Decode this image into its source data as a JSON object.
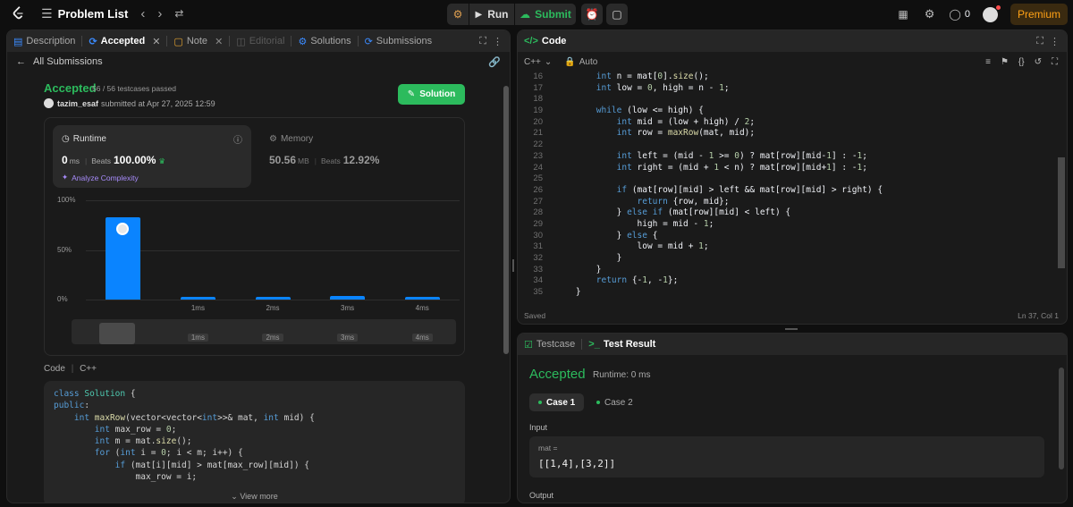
{
  "topbar": {
    "problem_list_label": "Problem List",
    "run_label": "Run",
    "submit_label": "Submit",
    "streak_count": "0",
    "premium_label": "Premium"
  },
  "left_tabs": {
    "description": "Description",
    "accepted": "Accepted",
    "note": "Note",
    "editorial": "Editorial",
    "solutions": "Solutions",
    "submissions": "Submissions"
  },
  "submission": {
    "back_label": "All Submissions",
    "status": "Accepted",
    "testcases": "56 / 56 testcases passed",
    "user": "tazim_esaf",
    "submitted_at": "submitted at Apr 27, 2025 12:59",
    "solution_button": "Solution",
    "runtime": {
      "label": "Runtime",
      "value": "0",
      "unit": "ms",
      "beats_label": "Beats",
      "beats_value": "100.00%",
      "analyze": "Analyze Complexity"
    },
    "memory": {
      "label": "Memory",
      "value": "50.56",
      "unit": "MB",
      "beats_label": "Beats",
      "beats_value": "12.92%"
    },
    "code_label": "Code",
    "lang": "C++",
    "view_more": "View more"
  },
  "chart_data": {
    "type": "bar",
    "y_tick_labels": [
      "100%",
      "50%",
      "0%"
    ],
    "categories": [
      "",
      "1ms",
      "2ms",
      "3ms",
      "4ms"
    ],
    "values": [
      83,
      3,
      3,
      4,
      3
    ],
    "ylim": [
      0,
      100
    ],
    "minimap_labels": [
      "1ms",
      "2ms",
      "3ms",
      "4ms"
    ]
  },
  "submission_code": [
    "class Solution {",
    "public:",
    "    int maxRow(vector<vector<int>>& mat, int mid) {",
    "        int max_row = 0;",
    "        int m = mat.size();",
    "        for (int i = 0; i < m; i++) {",
    "            if (mat[i][mid] > mat[max_row][mid]) {",
    "                max_row = i;"
  ],
  "editor": {
    "title": "Code",
    "lang": "C++",
    "mode": "Auto",
    "saved": "Saved",
    "cursor": "Ln 37, Col 1",
    "start_line": 16,
    "lines": [
      "        int n = mat[0].size();",
      "        int low = 0, high = n - 1;",
      "",
      "        while (low <= high) {",
      "            int mid = (low + high) / 2;",
      "            int row = maxRow(mat, mid);",
      "",
      "            int left = (mid - 1 >= 0) ? mat[row][mid-1] : -1;",
      "            int right = (mid + 1 < n) ? mat[row][mid+1] : -1;",
      "",
      "            if (mat[row][mid] > left && mat[row][mid] > right) {",
      "                return {row, mid};",
      "            } else if (mat[row][mid] < left) {",
      "                high = mid - 1;",
      "            } else {",
      "                low = mid + 1;",
      "            }",
      "        }",
      "        return {-1, -1};",
      "    }"
    ]
  },
  "result": {
    "tab_testcase": "Testcase",
    "tab_result": "Test Result",
    "status": "Accepted",
    "runtime": "Runtime: 0 ms",
    "case1": "Case 1",
    "case2": "Case 2",
    "input_label": "Input",
    "param_name": "mat =",
    "param_value": "[[1,4],[3,2]]",
    "output_label": "Output"
  }
}
